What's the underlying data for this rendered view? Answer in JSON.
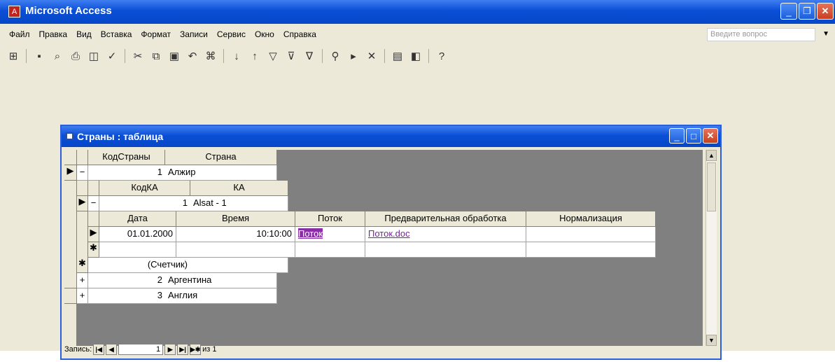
{
  "app": {
    "title": "Microsoft Access",
    "icon_name": "access-icon"
  },
  "window_controls": {
    "minimize": "minimize-icon",
    "maximize": "maximize-icon",
    "close": "close-icon"
  },
  "menu": {
    "items": [
      "Файл",
      "Правка",
      "Вид",
      "Вставка",
      "Формат",
      "Записи",
      "Сервис",
      "Окно",
      "Справка"
    ]
  },
  "help_box": {
    "placeholder": "Введите вопрос"
  },
  "toolbar": {
    "icons": [
      "view-icon",
      "save-icon",
      "search-icon",
      "print-icon",
      "print-preview-icon",
      "spelling-icon",
      "cut-icon",
      "copy-icon",
      "paste-icon",
      "undo-icon",
      "hyperlink-icon",
      "sort-asc-icon",
      "sort-desc-icon",
      "filter-selection-icon",
      "filter-form-icon",
      "apply-filter-icon",
      "find-icon",
      "new-record-icon",
      "delete-record-icon",
      "database-window-icon",
      "new-object-icon",
      "help-icon"
    ]
  },
  "child_window": {
    "title": "Страны : таблица"
  },
  "table": {
    "columns": {
      "id": "КодСтраны",
      "name": "Страна"
    },
    "rows": [
      {
        "id": "1",
        "name": "Алжир"
      },
      {
        "id": "2",
        "name": "Аргентина"
      },
      {
        "id": "3",
        "name": "Англия"
      }
    ],
    "subtable": {
      "columns": {
        "id": "КодКА",
        "name": "КА"
      },
      "rows": [
        {
          "id": "1",
          "name": "Alsat - 1"
        }
      ],
      "new_row": "(Счетчик)",
      "subtable": {
        "columns": [
          "Дата",
          "Время",
          "Поток",
          "Предварительная обработка",
          "Нормализация"
        ],
        "rows": [
          {
            "date": "01.01.2000",
            "time": "10:10:00",
            "stream": "Поток",
            "preprocessing": "Поток.doc",
            "normalization": ""
          }
        ]
      }
    }
  },
  "record_nav": {
    "label": "Запись:",
    "current": "1",
    "of_label": "из 1"
  }
}
